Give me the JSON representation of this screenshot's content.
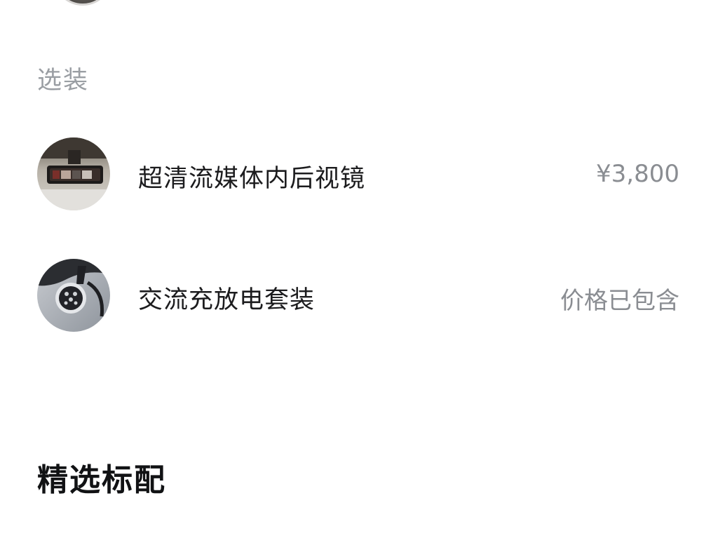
{
  "options_section": {
    "title": "选装",
    "items": [
      {
        "name": "超清流媒体内后视镜",
        "price": "¥3,800",
        "thumb_icon": "rearview-mirror-photo"
      },
      {
        "name": "交流充放电套装",
        "price": "价格已包含",
        "thumb_icon": "charging-port-photo"
      }
    ]
  },
  "featured_section": {
    "title": "精选标配"
  }
}
